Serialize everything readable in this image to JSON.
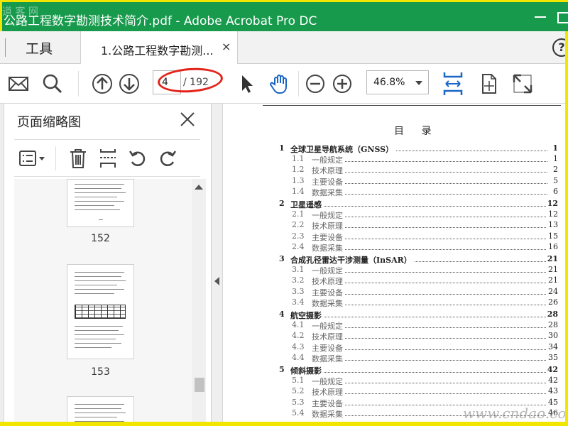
{
  "window": {
    "title": "公路工程数字勘测技术简介.pdf - Adobe Acrobat Pro DC",
    "watermark_tl": "道 客 网"
  },
  "tabs": {
    "tools_label": "工具",
    "doc_tab_label": "1.公路工程数字勘测...",
    "doc_tab_close": "×",
    "help": "?"
  },
  "toolbar": {
    "current_page": "4",
    "total_pages": "/ 192",
    "zoom": "46.8%"
  },
  "sidebar": {
    "title": "页面缩略图",
    "thumbnails": [
      {
        "label": "152"
      },
      {
        "label": "153"
      }
    ]
  },
  "document": {
    "toc_heading": "目 录",
    "entries": [
      {
        "num": "1",
        "text": "全球卫星导航系统（GNSS）",
        "page": "1",
        "level": "chap"
      },
      {
        "num": "1.1",
        "text": "一般规定",
        "page": "1",
        "level": "sub"
      },
      {
        "num": "1.2",
        "text": "技术原理",
        "page": "2",
        "level": "sub"
      },
      {
        "num": "1.3",
        "text": "主要设备",
        "page": "5",
        "level": "sub"
      },
      {
        "num": "1.4",
        "text": "数据采集",
        "page": "6",
        "level": "sub"
      },
      {
        "num": "2",
        "text": "卫星遥感",
        "page": "12",
        "level": "chap"
      },
      {
        "num": "2.1",
        "text": "一般规定",
        "page": "12",
        "level": "sub"
      },
      {
        "num": "2.2",
        "text": "技术原理",
        "page": "13",
        "level": "sub"
      },
      {
        "num": "2.3",
        "text": "主要设备",
        "page": "15",
        "level": "sub"
      },
      {
        "num": "2.4",
        "text": "数据采集",
        "page": "16",
        "level": "sub"
      },
      {
        "num": "3",
        "text": "合成孔径雷达干涉测量（InSAR）",
        "page": "21",
        "level": "chap"
      },
      {
        "num": "3.1",
        "text": "一般规定",
        "page": "21",
        "level": "sub"
      },
      {
        "num": "3.2",
        "text": "技术原理",
        "page": "21",
        "level": "sub"
      },
      {
        "num": "3.3",
        "text": "主要设备",
        "page": "24",
        "level": "sub"
      },
      {
        "num": "3.4",
        "text": "数据采集",
        "page": "26",
        "level": "sub"
      },
      {
        "num": "4",
        "text": "航空摄影",
        "page": "28",
        "level": "chap"
      },
      {
        "num": "4.1",
        "text": "一般规定",
        "page": "28",
        "level": "sub"
      },
      {
        "num": "4.2",
        "text": "技术原理",
        "page": "30",
        "level": "sub"
      },
      {
        "num": "4.3",
        "text": "主要设备",
        "page": "34",
        "level": "sub"
      },
      {
        "num": "4.4",
        "text": "数据采集",
        "page": "35",
        "level": "sub"
      },
      {
        "num": "5",
        "text": "倾斜摄影",
        "page": "42",
        "level": "chap"
      },
      {
        "num": "5.1",
        "text": "一般规定",
        "page": "42",
        "level": "sub"
      },
      {
        "num": "5.2",
        "text": "技术原理",
        "page": "43",
        "level": "sub"
      },
      {
        "num": "5.3",
        "text": "主要设备",
        "page": "45",
        "level": "sub"
      },
      {
        "num": "5.4",
        "text": "数据采集",
        "page": "46",
        "level": "sub"
      }
    ]
  },
  "watermark_br": "www.cndao.com",
  "icons": {
    "mail": "mail-icon",
    "search": "search-icon",
    "prev": "arrow-up-circle-icon",
    "next": "arrow-down-circle-icon",
    "select": "cursor-arrow-icon",
    "hand": "hand-icon",
    "zoom_out": "zoom-out-icon",
    "zoom_in": "zoom-in-icon",
    "fit_width": "fit-width-icon",
    "rotate": "page-rotate-icon",
    "fullscreen": "fullscreen-icon"
  },
  "colors": {
    "titlebar": "#179a4c",
    "accent_blue": "#1a66c5",
    "highlight_red": "#e3231a",
    "frame_yellow": "#f2e600"
  }
}
